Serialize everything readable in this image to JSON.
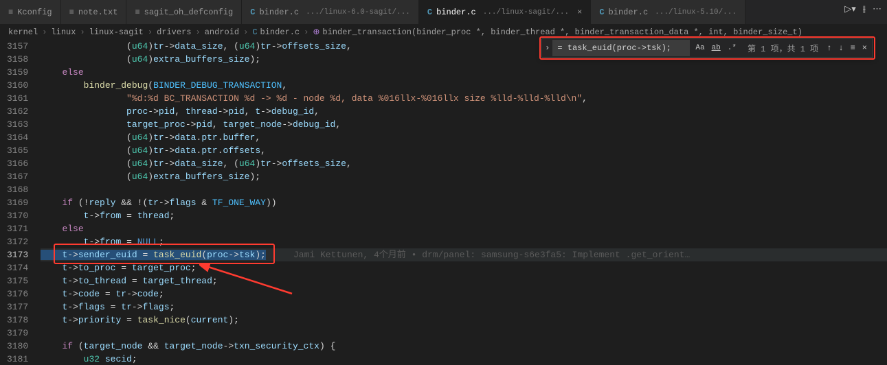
{
  "tabs": [
    {
      "icon": "≡",
      "label": "Kconfig",
      "active": false,
      "type": "text"
    },
    {
      "icon": "≡",
      "label": "note.txt",
      "active": false,
      "type": "text"
    },
    {
      "icon": "≡",
      "label": "sagit_oh_defconfig",
      "active": false,
      "type": "text"
    },
    {
      "icon": "C",
      "label": "binder.c",
      "sub": ".../linux-6.0-sagit/...",
      "active": false,
      "type": "c"
    },
    {
      "icon": "C",
      "label": "binder.c",
      "sub": ".../linux-sagit/...",
      "active": true,
      "type": "c"
    },
    {
      "icon": "C",
      "label": "binder.c",
      "sub": ".../linux-5.10/...",
      "active": false,
      "type": "c"
    }
  ],
  "breadcrumb": {
    "parts": [
      "kernel",
      "linux",
      "linux-sagit",
      "drivers",
      "android"
    ],
    "file": "binder.c",
    "function": "binder_transaction(binder_proc *, binder_thread *, binder_transaction_data *, int, binder_size_t)"
  },
  "find": {
    "value": "= task_euid(proc->tsk);",
    "opts": {
      "case": "Aa",
      "word": "ab",
      "regex": ".*"
    },
    "status": "第 1 项，共 1 项"
  },
  "lines": [
    3157,
    3158,
    3159,
    3160,
    3161,
    3162,
    3163,
    3164,
    3165,
    3166,
    3167,
    3168,
    3169,
    3170,
    3171,
    3172,
    3173,
    3174,
    3175,
    3176,
    3177,
    3178,
    3179,
    3180,
    3181
  ],
  "current_line": 3173,
  "blame": "Jami Kettunen, 4个月前 • drm/panel: samsung-s6e3fa5: Implement .get_orient…",
  "code": {
    "l3157": {
      "pre": "                (",
      "cast": "u64",
      "p1": ")",
      "v1": "tr",
      "op1": "->",
      "v2": "data_size",
      "p2": ", (",
      "cast2": "u64",
      "p3": ")",
      "v3": "tr",
      "op2": "->",
      "v4": "offsets_size",
      "p4": ","
    },
    "l3158": {
      "pre": "                (",
      "cast": "u64",
      "p1": ")",
      "v1": "extra_buffers_size",
      "p2": ");"
    },
    "l3159": {
      "kw": "else"
    },
    "l3160": {
      "pre": "        ",
      "fn": "binder_debug",
      "p1": "(",
      "c1": "BINDER_DEBUG_TRANSACTION",
      "p2": ","
    },
    "l3161": {
      "pre": "                ",
      "s": "\"%d:%d BC_TRANSACTION %d -> %d - node %d, data %016llx-%016llx size %lld-%lld-%lld\\n\"",
      "p": ","
    },
    "l3162": {
      "pre": "                ",
      "v1": "proc",
      "op1": "->",
      "v2": "pid",
      "p1": ", ",
      "v3": "thread",
      "op2": "->",
      "v4": "pid",
      "p2": ", ",
      "v5": "t",
      "op3": "->",
      "v6": "debug_id",
      "p3": ","
    },
    "l3163": {
      "pre": "                ",
      "v1": "target_proc",
      "op1": "->",
      "v2": "pid",
      "p1": ", ",
      "v3": "target_node",
      "op2": "->",
      "v4": "debug_id",
      "p2": ","
    },
    "l3164": {
      "pre": "                (",
      "cast": "u64",
      "p1": ")",
      "v1": "tr",
      "op1": "->",
      "v2": "data",
      "op2": ".",
      "v3": "ptr",
      "op3": ".",
      "v4": "buffer",
      "p2": ","
    },
    "l3165": {
      "pre": "                (",
      "cast": "u64",
      "p1": ")",
      "v1": "tr",
      "op1": "->",
      "v2": "data",
      "op2": ".",
      "v3": "ptr",
      "op3": ".",
      "v4": "offsets",
      "p2": ","
    },
    "l3166": {
      "pre": "                (",
      "cast": "u64",
      "p1": ")",
      "v1": "tr",
      "op1": "->",
      "v2": "data_size",
      "p2": ", (",
      "cast2": "u64",
      "p3": ")",
      "v3": "tr",
      "op2": "->",
      "v4": "offsets_size",
      "p4": ","
    },
    "l3167": {
      "pre": "                (",
      "cast": "u64",
      "p1": ")",
      "v1": "extra_buffers_size",
      "p2": ");"
    },
    "l3169": {
      "pre": "    ",
      "kw": "if",
      "p1": " (!",
      "v1": "reply",
      "p2": " && !(",
      "v2": "tr",
      "op": "->",
      "v3": "flags",
      "p3": " & ",
      "c": "TF_ONE_WAY",
      "p4": "))"
    },
    "l3170": {
      "pre": "        ",
      "v1": "t",
      "op": "->",
      "v2": "from",
      "p1": " = ",
      "v3": "thread",
      "p2": ";"
    },
    "l3171": {
      "pre": "    ",
      "kw": "else"
    },
    "l3172": {
      "pre": "        ",
      "v1": "t",
      "op": "->",
      "v2": "from",
      "p1": " = ",
      "c": "NULL",
      "p2": ";"
    },
    "l3173": {
      "pre": "    ",
      "v1": "t",
      "op1": "->",
      "v2": "sender_euid",
      "p1": " = ",
      "fn": "task_euid",
      "p2": "(",
      "v3": "proc",
      "op2": "->",
      "v4": "tsk",
      "p3": ");"
    },
    "l3174": {
      "pre": "    ",
      "v1": "t",
      "op1": "->",
      "v2": "to_proc",
      "p1": " = ",
      "v3": "target_proc",
      "p2": ";"
    },
    "l3175": {
      "pre": "    ",
      "v1": "t",
      "op1": "->",
      "v2": "to_thread",
      "p1": " = ",
      "v3": "target_thread",
      "p2": ";"
    },
    "l3176": {
      "pre": "    ",
      "v1": "t",
      "op1": "->",
      "v2": "code",
      "p1": " = ",
      "v3": "tr",
      "op2": "->",
      "v4": "code",
      "p2": ";"
    },
    "l3177": {
      "pre": "    ",
      "v1": "t",
      "op1": "->",
      "v2": "flags",
      "p1": " = ",
      "v3": "tr",
      "op2": "->",
      "v4": "flags",
      "p2": ";"
    },
    "l3178": {
      "pre": "    ",
      "v1": "t",
      "op1": "->",
      "v2": "priority",
      "p1": " = ",
      "fn": "task_nice",
      "p2": "(",
      "v3": "current",
      "p3": ");"
    },
    "l3180": {
      "pre": "    ",
      "kw": "if",
      "p1": " (",
      "v1": "target_node",
      "p2": " && ",
      "v2": "target_node",
      "op": "->",
      "v3": "txn_security_ctx",
      "p3": ") {"
    },
    "l3181": {
      "pre": "        ",
      "t": "u32",
      "sp": " ",
      "v": "secid",
      "p": ";"
    }
  }
}
